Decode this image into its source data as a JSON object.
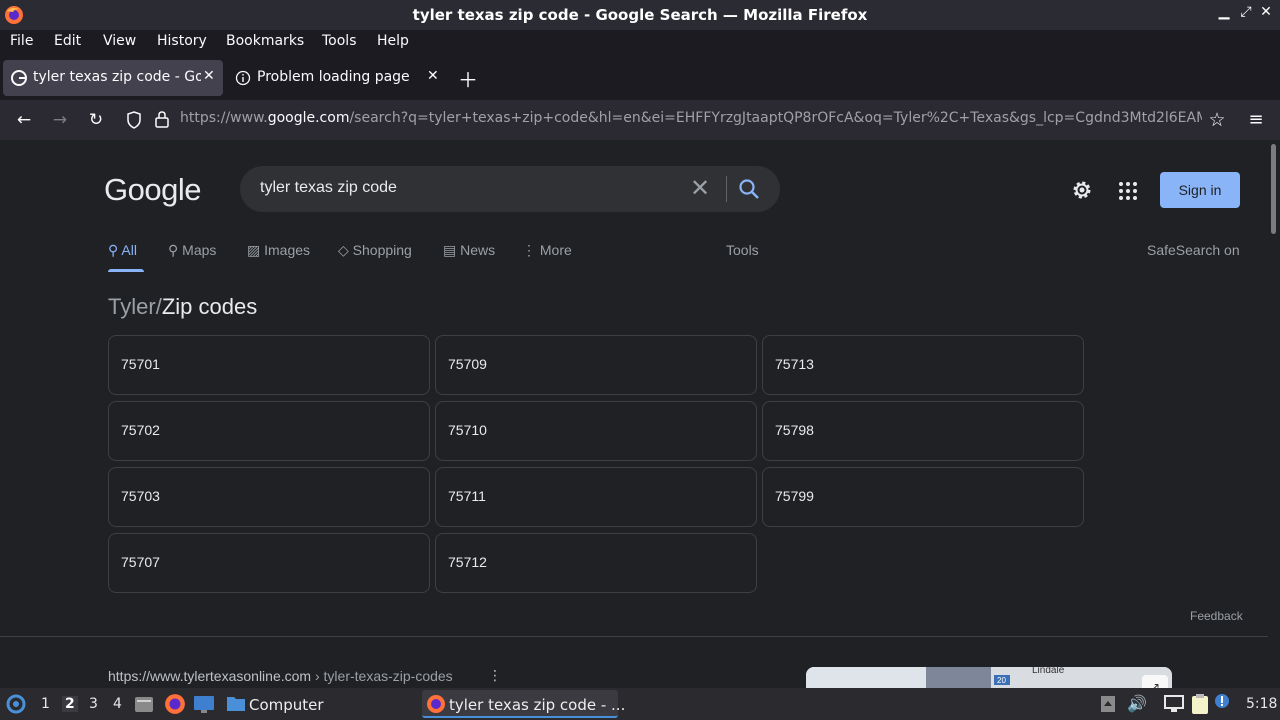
{
  "window": {
    "title": "tyler texas zip code - Google Search — Mozilla Firefox",
    "controls": [
      "minimize",
      "maximize",
      "close"
    ]
  },
  "menubar": {
    "items": [
      "File",
      "Edit",
      "View",
      "History",
      "Bookmarks",
      "Tools",
      "Help"
    ]
  },
  "tabs": [
    {
      "label": "tyler texas zip code - Goo",
      "active": true,
      "icon": "google-favicon"
    },
    {
      "label": "Problem loading page",
      "active": false,
      "icon": "info-icon"
    }
  ],
  "navbar": {
    "url_domain_prefix": "https://www.",
    "url_domain": "google.com",
    "url_rest": "/search?q=tyler+texas+zip+code&hl=en&ei=EHFFYrzgJtaaptQP8rOFcA&oq=Tyler%2C+Texas&gs_lcp=Cgdnd3Mtd2l6EAM"
  },
  "google": {
    "logo": "Google",
    "query": "tyler texas zip code",
    "sign_in": "Sign in",
    "tabs": [
      {
        "label": "All",
        "icon": "search-icon",
        "active": true
      },
      {
        "label": "Maps",
        "icon": "map-pin-icon",
        "active": false
      },
      {
        "label": "Images",
        "icon": "image-icon",
        "active": false
      },
      {
        "label": "Shopping",
        "icon": "tag-icon",
        "active": false
      },
      {
        "label": "News",
        "icon": "news-icon",
        "active": false
      },
      {
        "label": "More",
        "icon": "more-vert-icon",
        "active": false
      }
    ],
    "tools": "Tools",
    "safesearch": "SafeSearch on",
    "breadcrumb": {
      "parent": "Tyler",
      "separator": "/",
      "current": "Zip codes"
    },
    "zip_codes": [
      "75701",
      "75709",
      "75713",
      "75702",
      "75710",
      "75798",
      "75703",
      "75711",
      "75799",
      "75707",
      "75712"
    ],
    "feedback": "Feedback",
    "result": {
      "url": "https://www.tylertexasonline.com",
      "path": " › tyler-texas-zip-codes"
    },
    "map_labels": [
      "Lindale",
      "20"
    ]
  },
  "taskbar": {
    "workspaces": [
      "1",
      "2",
      "3",
      "4"
    ],
    "current_workspace": "2",
    "tasks": [
      {
        "label": "Computer",
        "icon": "folder-icon"
      },
      {
        "label": "tyler texas zip code - ...",
        "icon": "firefox-icon"
      }
    ],
    "clock": "5:18"
  },
  "colors": {
    "accent": "#8ab4f8",
    "page_bg": "#202124",
    "chrome_bg": "#1c1b22"
  }
}
